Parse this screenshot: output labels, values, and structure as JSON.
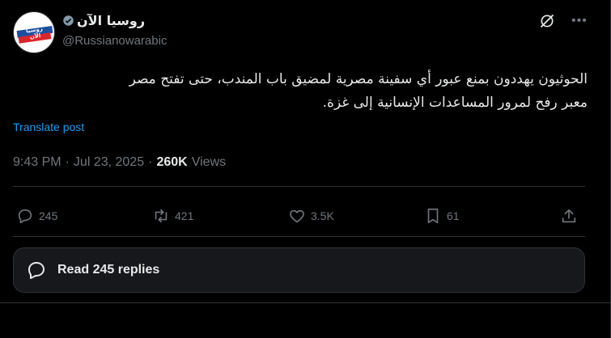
{
  "account": {
    "display_name": "روسيا الآن",
    "handle": "@Russianowarabic",
    "avatar_text": "روسيا الآن"
  },
  "post": {
    "text_line1": "الحوثيون يهددون بمنع عبور أي سفينة مصرية لمضيق باب المندب، حتى تفتح مصر",
    "text_line2": "معبر رفح لمرور المساعدات الإنسانية إلى غزة.",
    "translate_label": "Translate post",
    "time": "9:43 PM",
    "date": "Jul 23, 2025",
    "separator": "·",
    "views_count": "260K",
    "views_label": "Views"
  },
  "actions": {
    "replies": "245",
    "reposts": "421",
    "likes": "3.5K",
    "bookmarks": "61"
  },
  "replies_button": {
    "label": "Read 245 replies"
  },
  "icons": {
    "verified": "verified-badge-icon",
    "grok": "grok-icon",
    "more": "more-icon",
    "reply": "reply-icon",
    "repost": "repost-icon",
    "like": "heart-icon",
    "bookmark": "bookmark-icon",
    "share": "share-icon"
  },
  "colors": {
    "background": "#000000",
    "text": "#e7e9ea",
    "muted": "#71767b",
    "link": "#1d9bf0",
    "border": "#2f3336"
  }
}
